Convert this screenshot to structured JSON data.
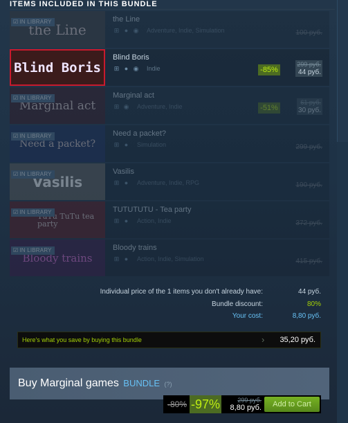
{
  "header": {
    "title": "ITEMS INCLUDED IN THIS BUNDLE"
  },
  "badges": {
    "in_library": "IN LIBRARY"
  },
  "items": [
    {
      "name": "the Line",
      "capsule_text": "the Line",
      "tags": "Adventure, Indie, Simulation",
      "owned": true,
      "price": "100 руб.",
      "capsule_color": "#3b3c42"
    },
    {
      "name": "Blind Boris",
      "capsule_text": "Blind Boris",
      "tags": "Indie",
      "owned": false,
      "selected": true,
      "discount": "-85%",
      "original_price": "299 руб.",
      "final_price": "44 руб.",
      "capsule_color": "#3b1b1b"
    },
    {
      "name": "Marginal act",
      "capsule_text": "Marginal act",
      "tags": "Adventure, Indie",
      "owned": true,
      "discount": "-51%",
      "original_price": "61 руб.",
      "final_price": "30 руб.",
      "capsule_color": "#3a1c27"
    },
    {
      "name": "Need a packet?",
      "capsule_text": "Need a packet?",
      "tags": "Simulation",
      "owned": true,
      "price": "299 руб.",
      "capsule_color": "#1c2e5a"
    },
    {
      "name": "Vasilis",
      "capsule_text": "Vasilis",
      "tags": "Adventure, Indie, RPG",
      "owned": true,
      "price": "190 руб.",
      "capsule_color": "#5e5e5e"
    },
    {
      "name": "TUTUTUTU - Tea party",
      "capsule_text": "TuTu TuTu tea party",
      "tags": "Action, Indie",
      "owned": true,
      "price": "372 руб.",
      "capsule_color": "#5a1c24"
    },
    {
      "name": "Bloody trains",
      "capsule_text": "Bloody trains",
      "tags": "Action, Indie, Simulation",
      "owned": true,
      "price": "415 руб.",
      "capsule_color": "#3a1c4a"
    }
  ],
  "summary": {
    "individual_label": "Individual price of the 1 items you don't already have:",
    "individual_value": "44 руб.",
    "discount_label": "Bundle discount:",
    "discount_value": "80%",
    "cost_label": "Your cost:",
    "cost_value": "8,80 руб."
  },
  "save": {
    "label": "Here's what you save by buying this bundle",
    "amount": "35,20 руб."
  },
  "buy": {
    "title": "Buy Marginal games",
    "bundle_word": "BUNDLE",
    "help": "(?)",
    "bundle_discount": "-80%",
    "discount": "-97%",
    "original_price": "299 руб.",
    "final_price": "8,80 руб.",
    "add_to_cart": "Add to Cart"
  },
  "colors": {
    "accent_green": "#a4d007",
    "discount_bg": "#4c6b22",
    "link_blue": "#67c1f5",
    "selected_border": "#c91a2d"
  }
}
